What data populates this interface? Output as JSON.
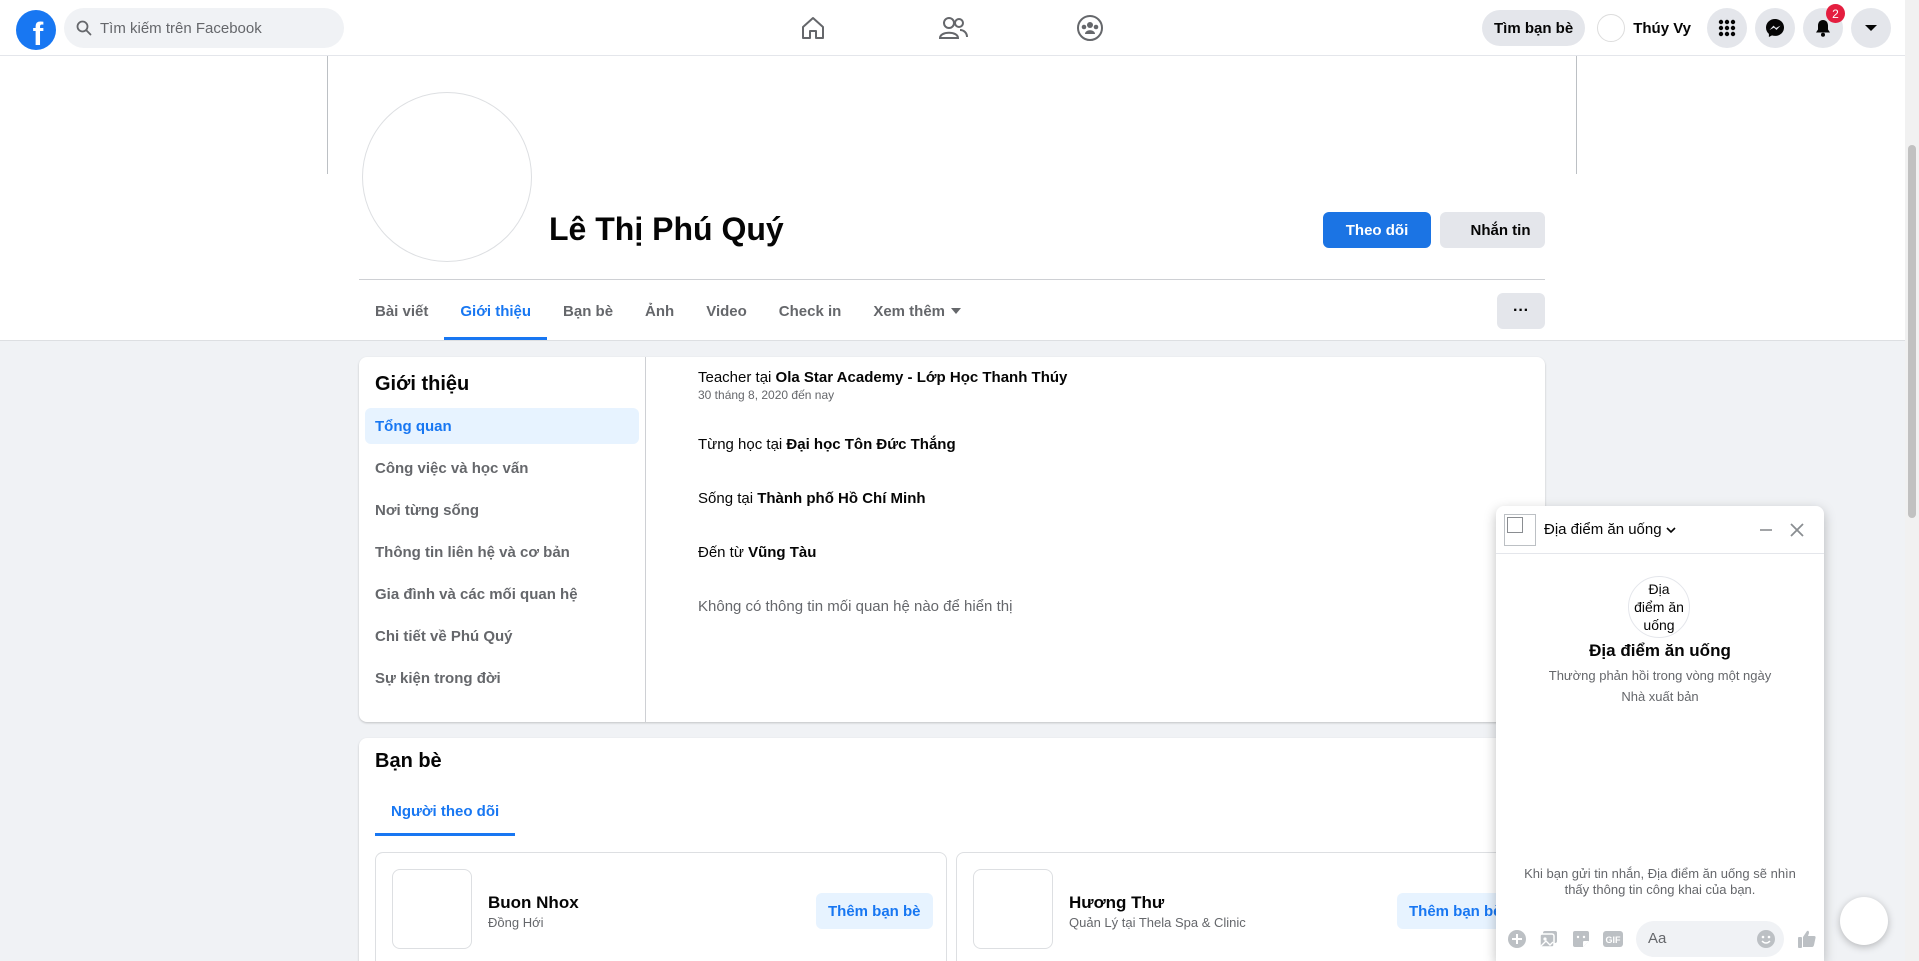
{
  "topbar": {
    "logo_letter": "f",
    "search_placeholder": "Tìm kiếm trên Facebook",
    "find_friends_label": "Tìm bạn bè",
    "user_name": "Thúy Vy",
    "notification_count": "2",
    "nav_icons": [
      "home-icon",
      "friends-icon",
      "groups-icon"
    ],
    "right_icons": [
      "menu-grid-icon",
      "messenger-icon",
      "bell-icon",
      "account-caret-icon"
    ]
  },
  "profile": {
    "name": "Lê Thị Phú Quý",
    "follow_label": "Theo dõi",
    "message_label": "Nhắn tin",
    "more_label": "···",
    "tabs": [
      {
        "label": "Bài viết"
      },
      {
        "label": "Giới thiệu"
      },
      {
        "label": "Bạn bè"
      },
      {
        "label": "Ảnh"
      },
      {
        "label": "Video"
      },
      {
        "label": "Check in"
      },
      {
        "label": "Xem thêm"
      }
    ],
    "active_tab": "Giới thiệu"
  },
  "about": {
    "title": "Giới thiệu",
    "menu": [
      "Tổng quan",
      "Công việc và học vấn",
      "Nơi từng sống",
      "Thông tin liên hệ và cơ bản",
      "Gia đình và các mối quan hệ",
      "Chi tiết về Phú Quý",
      "Sự kiện trong đời"
    ],
    "active_menu": "Tổng quan",
    "work": {
      "prefix": "Teacher tại ",
      "place": "Ola Star Academy - Lớp Học Thanh Thúy",
      "period": "30 tháng 8, 2020 đến nay"
    },
    "study": {
      "prefix": "Từng học tại ",
      "place": "Đại học Tôn Đức Thắng"
    },
    "lives": {
      "prefix": "Sống tại ",
      "place": "Thành phố Hồ Chí Minh"
    },
    "from": {
      "prefix": "Đến từ ",
      "place": "Vũng Tàu"
    },
    "relationship": "Không có thông tin mối quan hệ nào để hiển thị"
  },
  "friends": {
    "title": "Bạn bè",
    "tab_label": "Người theo dõi",
    "items": [
      {
        "name": "Buon Nhox",
        "sub": "Đồng Hới",
        "button": "Thêm bạn bè"
      },
      {
        "name": "Hương Thư",
        "sub": "Quản Lý tại Thela Spa & Clinic",
        "button": "Thêm bạn bè"
      }
    ]
  },
  "chat": {
    "page_name": "Địa điểm ăn uống",
    "page_pic_alt": "Địa điểm ăn uống",
    "title": "Địa điểm ăn uống",
    "response": "Thường phản hồi trong vòng một ngày",
    "page_type": "Nhà xuất bản",
    "notice": "Khi bạn gửi tin nhắn, Địa điểm ăn uống sẽ nhìn thấy thông tin công khai của bạn.",
    "input_placeholder": "Aa"
  },
  "colors": {
    "brand": "#1877f2",
    "badge": "#e41e3f",
    "muted": "#65676b"
  }
}
